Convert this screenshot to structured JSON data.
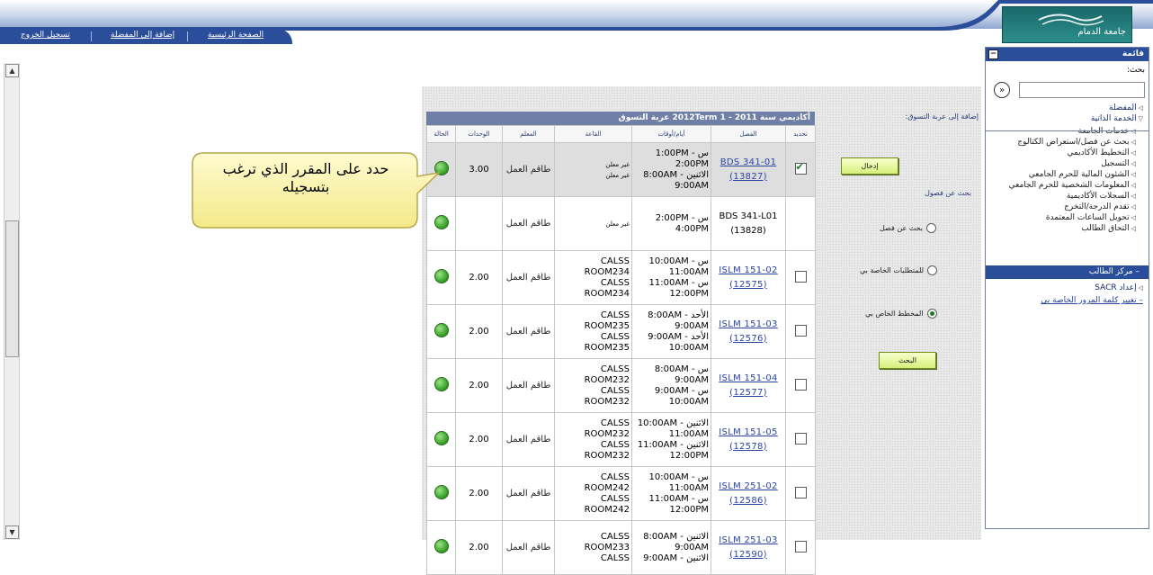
{
  "header": {
    "nav_links": [
      "الصفحة الرئيسية",
      "إضافة إلى المفضلة",
      "تسجيل الخروج"
    ],
    "logo_text": "جامعة الدمام"
  },
  "table": {
    "header_title": "أكاديمي سنة 2011 - 1 2012Term عربة التسوق",
    "columns": [
      "تحديد",
      "الفصل",
      "أيام/أوقات",
      "القاعة",
      "المعلم",
      "الوحدات",
      "الحالة"
    ],
    "rows": [
      {
        "selected": true,
        "checkbox": true,
        "class_link": "BDS 341-01",
        "class_id": "(13827)",
        "time": [
          "س - 1:00PM",
          "2:00PM",
          "الاثنين - 8:00AM",
          "9:00AM"
        ],
        "room": [
          "غير معلن",
          "غير معلن"
        ],
        "instructor": "طاقم العمل",
        "units": "3.00"
      },
      {
        "selected": false,
        "checkbox": false,
        "class_plain": "BDS 341-L01",
        "class_id": "(13828)",
        "time": [
          "س - 2:00PM",
          "4:00PM"
        ],
        "room": [
          "غير معلن"
        ],
        "instructor": "طاقم العمل",
        "units": ""
      },
      {
        "selected": false,
        "checkbox": true,
        "class_link": "ISLM 151-02",
        "class_id": "(12575)",
        "time": [
          "س - 10:00AM",
          "11:00AM",
          "س - 11:00AM",
          "12:00PM"
        ],
        "room": [
          "CALSS",
          "ROOM234",
          "CALSS",
          "ROOM234"
        ],
        "instructor": "طاقم العمل",
        "units": "2.00"
      },
      {
        "selected": false,
        "checkbox": true,
        "class_link": "ISLM 151-03",
        "class_id": "(12576)",
        "time": [
          "الأحد - 8:00AM",
          "9:00AM",
          "الأحد - 9:00AM",
          "10:00AM"
        ],
        "room": [
          "CALSS",
          "ROOM235",
          "CALSS",
          "ROOM235"
        ],
        "instructor": "طاقم العمل",
        "units": "2.00"
      },
      {
        "selected": false,
        "checkbox": true,
        "class_link": "ISLM 151-04",
        "class_id": "(12577)",
        "time": [
          "س - 8:00AM",
          "9:00AM",
          "س - 9:00AM",
          "10:00AM"
        ],
        "room": [
          "CALSS",
          "ROOM232",
          "CALSS",
          "ROOM232"
        ],
        "instructor": "طاقم العمل",
        "units": "2.00"
      },
      {
        "selected": false,
        "checkbox": true,
        "class_link": "ISLM 151-05",
        "class_id": "(12578)",
        "time": [
          "الاثنين - 10:00AM",
          "11:00AM",
          "الاثنين - 11:00AM",
          "12:00PM"
        ],
        "room": [
          "CALSS",
          "ROOM232",
          "CALSS",
          "ROOM232"
        ],
        "instructor": "طاقم العمل",
        "units": "2.00"
      },
      {
        "selected": false,
        "checkbox": true,
        "class_link": "ISLM 251-02",
        "class_id": "(12586)",
        "time": [
          "س - 10:00AM",
          "11:00AM",
          "س - 11:00AM",
          "12:00PM"
        ],
        "room": [
          "CALSS",
          "ROOM242",
          "CALSS",
          "ROOM242"
        ],
        "instructor": "طاقم العمل",
        "units": "2.00"
      },
      {
        "selected": false,
        "checkbox": true,
        "class_link": "ISLM 251-03",
        "class_id": "(12590)",
        "time": [
          "الاثنين - 8:00AM",
          "9:00AM",
          "الاثنين - 9:00AM"
        ],
        "room": [
          "CALSS",
          "ROOM233",
          "CALSS"
        ],
        "instructor": "طاقم العمل",
        "units": "2.00"
      }
    ]
  },
  "controls": {
    "add_to_cart_label": "إضافة إلى عربة التسوق:",
    "enter_button": "إدخال",
    "search_class_label": "بحث عن فصول",
    "radio_options": [
      {
        "label": "بحث عن فصل",
        "checked": false
      },
      {
        "label": "للمتطلبات الخاصة بي",
        "checked": false
      },
      {
        "label": "المخطط الخاص بي",
        "checked": true
      }
    ],
    "search_button": "البحث"
  },
  "callout": {
    "text": "حدد على المقرر الذي ترغب بتسجيله"
  },
  "menu": {
    "title": "قائمة",
    "search_label": "بحث:",
    "search_value": "",
    "items": [
      {
        "label": "المفضلة",
        "type": "folder"
      },
      {
        "label": "الخدمة الذاتية",
        "type": "open"
      },
      {
        "label": "خدمات الجامعة",
        "type": "sub"
      },
      {
        "label": "بحث عن فصل/استعراض الكتالوج",
        "type": "sub"
      },
      {
        "label": "التخطيط الأكاديمي",
        "type": "sub"
      },
      {
        "label": "التسجيل",
        "type": "sub"
      },
      {
        "label": "الشئون المالية للحرم الجامعي",
        "type": "sub"
      },
      {
        "label": "المعلومات الشخصية للحرم الجامعي",
        "type": "sub"
      },
      {
        "label": "السجلات الأكاديمية",
        "type": "sub"
      },
      {
        "label": "تقدم الدرجة/التخرج",
        "type": "sub"
      },
      {
        "label": "تحويل الساعات المعتمدة",
        "type": "sub"
      },
      {
        "label": "التحاق الطالب",
        "type": "sub"
      }
    ],
    "highlight": "– مركز الطالب",
    "sacr": "إعداد SACR",
    "change_password": "– تغيير كلمة المرور الخاصة بي"
  }
}
